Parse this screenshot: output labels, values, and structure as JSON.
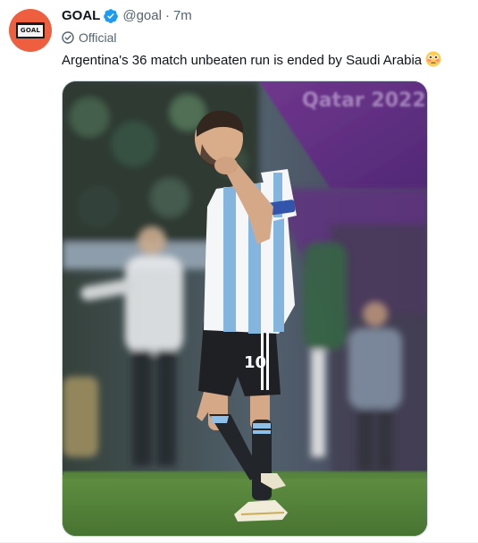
{
  "tweet": {
    "author_name": "GOAL",
    "author_handle": "@goal",
    "separator": "·",
    "timestamp": "7m",
    "label": "Official",
    "text": "Argentina's 36 match unbeaten run is ended by Saudi Arabia",
    "avatar_text": "GOAL",
    "avatar_icon": "goal-logo-icon",
    "verified_icon": "verified-badge-icon",
    "label_icon": "check-circle-icon",
    "emoji_icon": "flushed-face-emoji-icon"
  },
  "media": {
    "jersey_number": "10",
    "banner_text": "Qatar 2022"
  },
  "colors": {
    "avatar_bg": "#ee5f3f",
    "verified_blue": "#1d9bf0",
    "text_primary": "#0f1419",
    "text_secondary": "#536471"
  }
}
